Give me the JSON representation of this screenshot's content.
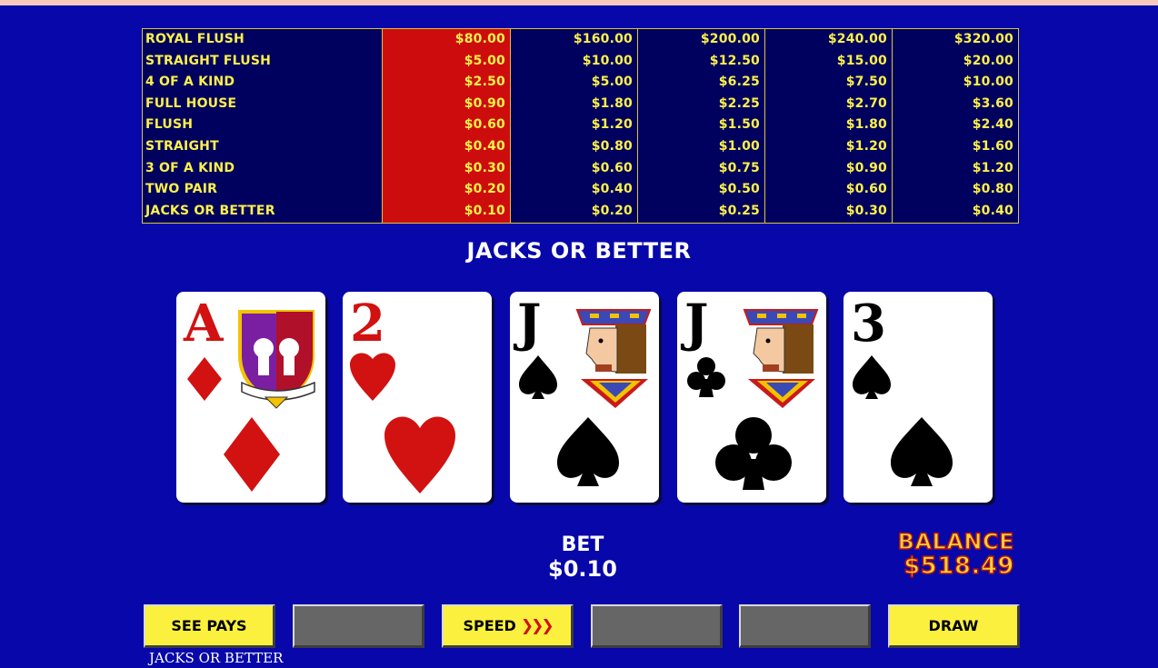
{
  "paytable": {
    "hands": [
      "ROYAL FLUSH",
      "STRAIGHT FLUSH",
      "4 OF A KIND",
      "FULL HOUSE",
      "FLUSH",
      "STRAIGHT",
      "3 OF A KIND",
      "TWO PAIR",
      "JACKS OR BETTER"
    ],
    "columns": [
      [
        "$80.00",
        "$5.00",
        "$2.50",
        "$0.90",
        "$0.60",
        "$0.40",
        "$0.30",
        "$0.20",
        "$0.10"
      ],
      [
        "$160.00",
        "$10.00",
        "$5.00",
        "$1.80",
        "$1.20",
        "$0.80",
        "$0.60",
        "$0.40",
        "$0.20"
      ],
      [
        "$200.00",
        "$12.50",
        "$6.25",
        "$2.25",
        "$1.50",
        "$1.00",
        "$0.75",
        "$0.50",
        "$0.25"
      ],
      [
        "$240.00",
        "$15.00",
        "$7.50",
        "$2.70",
        "$1.80",
        "$1.20",
        "$0.90",
        "$0.60",
        "$0.30"
      ],
      [
        "$320.00",
        "$20.00",
        "$10.00",
        "$3.60",
        "$2.40",
        "$1.60",
        "$1.20",
        "$0.80",
        "$0.40"
      ]
    ],
    "active_column": 0,
    "colors": {
      "active": "#cd0d0d",
      "text": "#fcf14a",
      "background": "#00005e"
    }
  },
  "game_title": "JACKS OR BETTER",
  "cards": [
    {
      "rank": "A",
      "suit": "diamonds",
      "color": "red",
      "face": "crest"
    },
    {
      "rank": "2",
      "suit": "hearts",
      "color": "red",
      "face": "none"
    },
    {
      "rank": "J",
      "suit": "spades",
      "color": "black",
      "face": "jack"
    },
    {
      "rank": "J",
      "suit": "clubs",
      "color": "black",
      "face": "jack"
    },
    {
      "rank": "3",
      "suit": "spades",
      "color": "black",
      "face": "none"
    }
  ],
  "bet": {
    "label": "BET",
    "value": "$0.10"
  },
  "balance": {
    "label": "BALANCE",
    "value": "$518.49"
  },
  "buttons": {
    "see_pays": "SEE PAYS",
    "speed": "SPEED",
    "speed_icon": "triple-chevron-right",
    "draw": "DRAW"
  },
  "footer": {
    "label": "JACKS OR BETTER"
  }
}
